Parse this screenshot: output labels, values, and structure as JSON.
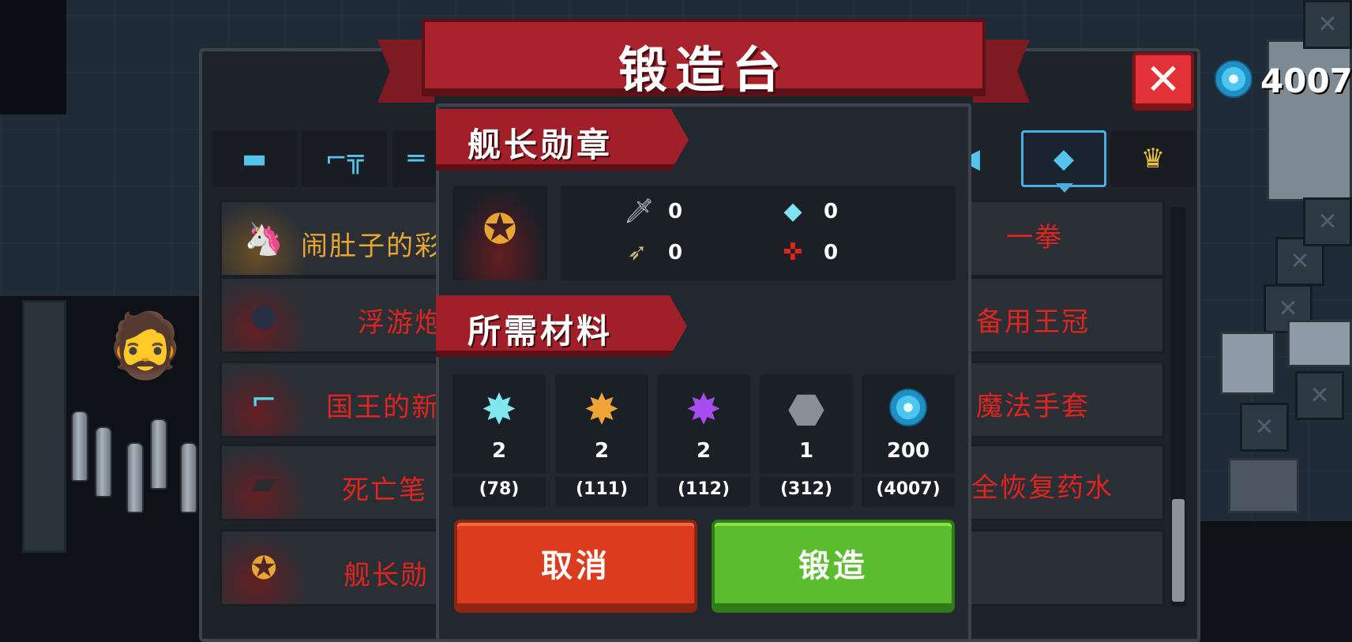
{
  "title": "锻造台",
  "currency": {
    "amount": "4007",
    "icon": "blue-gem-icon"
  },
  "close_label": "✕",
  "tabs": [
    {
      "icon": "pistol-icon",
      "glyph": "▬"
    },
    {
      "icon": "rifle-icon",
      "glyph": "⌐╦"
    },
    {
      "icon": "shotgun-icon",
      "glyph": "═"
    },
    {
      "icon": "fish-weapon-icon",
      "glyph": "◀"
    },
    {
      "icon": "fish-weapon-icon",
      "glyph": "◆"
    },
    {
      "icon": "crown-icon",
      "glyph": "♛"
    }
  ],
  "list": {
    "left_items": [
      {
        "name": "闹肚子的彩",
        "icon": "unicorn-icon",
        "glyph": "🦄"
      },
      {
        "name": "浮游炮",
        "icon": "orb-icon",
        "glyph": "●"
      },
      {
        "name": "国王的新",
        "icon": "outline-gun-icon",
        "glyph": "⌐"
      },
      {
        "name": "死亡笔",
        "icon": "notebook-icon",
        "glyph": "▰"
      },
      {
        "name": "舰长勋",
        "icon": "medal-icon",
        "glyph": "✪"
      }
    ],
    "right_items": [
      "一拳",
      "备用王冠",
      "魔法手套",
      "全恢复药水"
    ]
  },
  "detail": {
    "item_name": "舰长勋章",
    "item_icon": "medal-icon",
    "stats": [
      {
        "icon": "sword-icon",
        "glyph": "🗡",
        "value": "0"
      },
      {
        "icon": "diamond-icon",
        "glyph": "◆",
        "value": "0"
      },
      {
        "icon": "bullet-icon",
        "glyph": "➶",
        "value": "0"
      },
      {
        "icon": "crosshair-icon",
        "glyph": "✜",
        "value": "0"
      }
    ],
    "materials_title": "所需材料",
    "materials": [
      {
        "icon": "cyan-crystal-icon",
        "glyph": "✸",
        "color": "#7ee8ee",
        "need": "2",
        "have": "(78)"
      },
      {
        "icon": "orange-crystal-icon",
        "glyph": "✸",
        "color": "#f0a338",
        "need": "2",
        "have": "(111)"
      },
      {
        "icon": "purple-crystal-icon",
        "glyph": "✸",
        "color": "#a64cf0",
        "need": "2",
        "have": "(112)"
      },
      {
        "icon": "iron-ore-icon",
        "glyph": "⬣",
        "color": "#8a8f96",
        "need": "1",
        "have": "(312)"
      },
      {
        "icon": "blue-gem-icon",
        "glyph": "",
        "color": "#4ac6f0",
        "need": "200",
        "have": "(4007)"
      }
    ],
    "cancel_label": "取消",
    "forge_label": "锻造"
  },
  "colors": {
    "accent_red": "#a8232c",
    "cancel": "#dc3b1d",
    "forge": "#5bbc2f",
    "item_name_red": "#e0241e",
    "item_name_orange": "#e8a531",
    "tab_blue": "#55c4ec"
  }
}
